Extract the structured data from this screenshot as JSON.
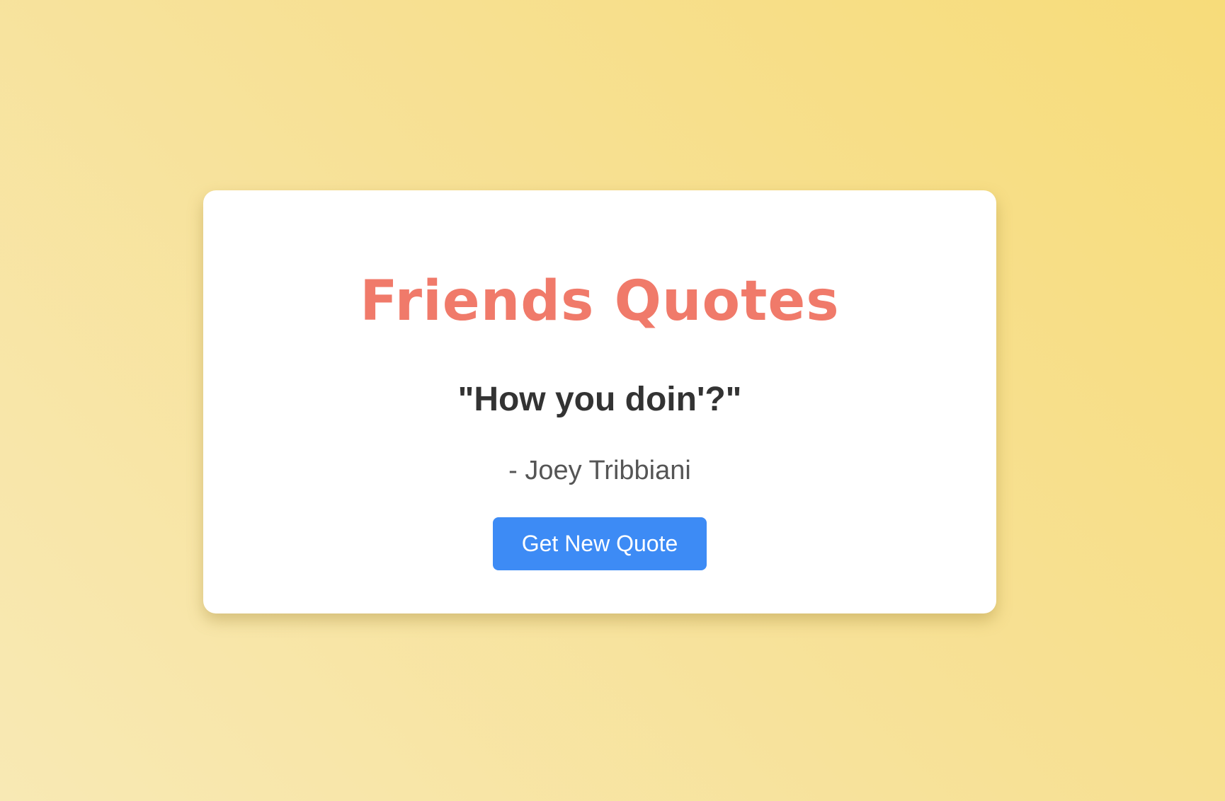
{
  "card": {
    "title": "Friends Quotes",
    "quote": "\"How you doin'?\"",
    "author": "- Joey Tribbiani",
    "button_label": "Get New Quote"
  },
  "colors": {
    "title": "#f07a6a",
    "button": "#3d8bf5",
    "background_start": "#f8e9b4",
    "background_end": "#f7dc7a"
  }
}
